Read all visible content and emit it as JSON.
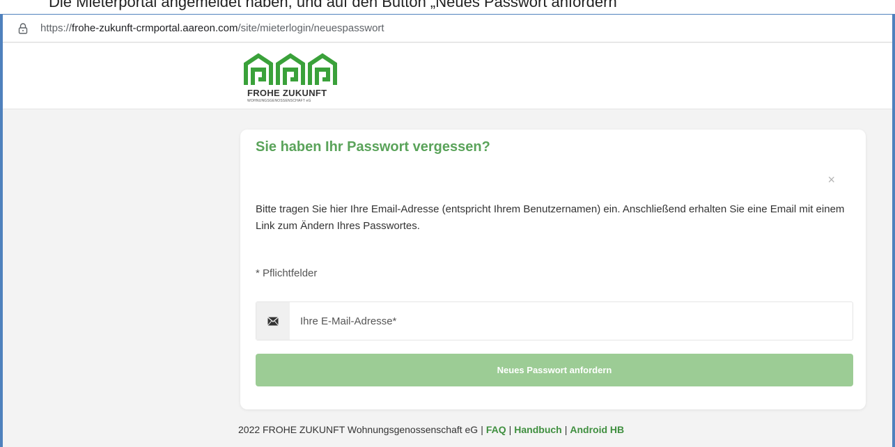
{
  "browser": {
    "url_prefix": "https://",
    "url_host": "frohe-zukunft-crmportal.aareon.com",
    "url_path": "/site/mieterlogin/neuespasswort"
  },
  "doc_fragment": "Die Mieterportal angemeldet haben, und auf den Button „Neues Passwort anfordern“",
  "logo": {
    "name": "FROHE ZUKUNFT",
    "subtitle": "WOHNUNGSGENOSSENSCHAFT eG"
  },
  "card": {
    "title": "Sie haben Ihr Passwort vergessen?",
    "close_symbol": "×",
    "instructions": "Bitte tragen Sie hier Ihre Email-Adresse (entspricht Ihrem Benutzernamen) ein. Anschließend erhalten Sie eine Email mit einem Link zum Ändern Ihres Passwortes.",
    "required_note": "* Pflichtfelder",
    "email_placeholder": "Ihre E-Mail-Adresse*",
    "email_value": "",
    "submit_label": "Neues Passwort anfordern"
  },
  "footer": {
    "copyright": "2022 FROHE ZUKUNFT Wohnungsgenossenschaft eG",
    "separator": "|",
    "links": [
      "FAQ",
      "Handbuch",
      "Android HB"
    ]
  },
  "colors": {
    "brand_green": "#5aa35a",
    "button_green": "#9ccc95",
    "frame_blue": "#4f81bd"
  },
  "icons": {
    "lock": "lock-icon",
    "envelope": "envelope-icon",
    "close": "close-icon",
    "logo": "house-logo-icon"
  }
}
